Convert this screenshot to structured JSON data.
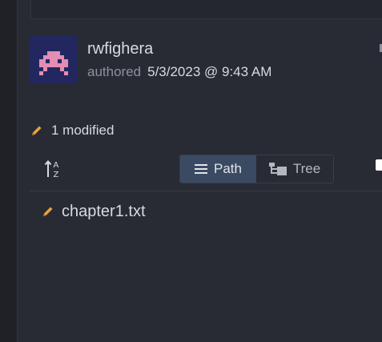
{
  "commit": {
    "author": {
      "name": "rwfighera",
      "verb": "authored",
      "date": "5/3/2023 @ 9:43 AM",
      "avatar_colors": {
        "background": "#23275f",
        "figure": "#e28db4"
      }
    }
  },
  "changes": {
    "summary": "1 modified",
    "status_color": "#e8a23d"
  },
  "toolbar": {
    "sort_icon": "sort-alpha-icon",
    "view_toggle": {
      "selected": "Path",
      "options": [
        {
          "label": "Path",
          "icon": "list-icon"
        },
        {
          "label": "Tree",
          "icon": "tree-icon"
        }
      ]
    }
  },
  "files": [
    {
      "name": "chapter1.txt",
      "status": "modified",
      "icon": "pencil-icon"
    }
  ],
  "colors": {
    "background": "#282b33",
    "selected_segment": "#3a4a63",
    "text": "#d7dae0",
    "muted_text": "#8c919c"
  }
}
